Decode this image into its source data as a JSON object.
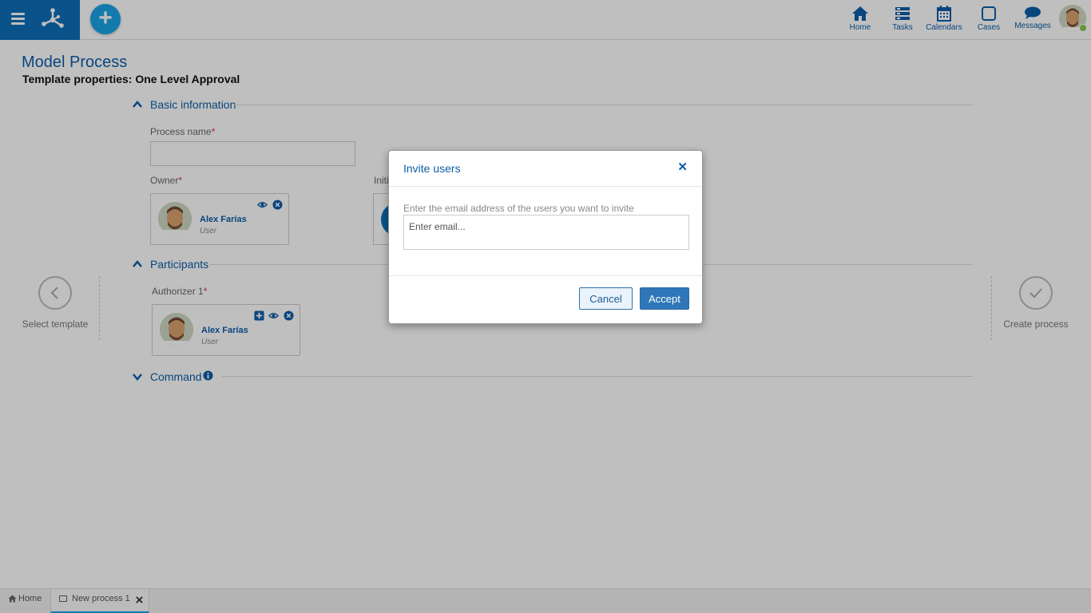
{
  "header": {
    "nav": [
      {
        "label": "Home",
        "icon": "home-icon"
      },
      {
        "label": "Tasks",
        "icon": "tasks-icon"
      },
      {
        "label": "Calendars",
        "icon": "calendar-icon"
      },
      {
        "label": "Cases",
        "icon": "cases-icon"
      },
      {
        "label": "Messages",
        "icon": "messages-icon"
      }
    ]
  },
  "page": {
    "title": "Model Process",
    "subtitle": "Template properties: One Level Approval"
  },
  "sections": {
    "basic": "Basic information",
    "participants": "Participants",
    "command": "Command"
  },
  "fields": {
    "process_name_label": "Process name",
    "owner_label": "Owner",
    "initiator_partial_label": "Initi",
    "authorizer_label": "Authorizer 1",
    "required_mark": "*"
  },
  "owner_card": {
    "name": "Alex Farías",
    "role": "User"
  },
  "authorizer_card": {
    "name": "Alex Farías",
    "role": "User"
  },
  "steps": {
    "prev": "Select template",
    "next": "Create process"
  },
  "bottom_tabs": [
    {
      "label": "Home",
      "icon": "home-icon"
    },
    {
      "label": "New process 1",
      "icon": "window-icon"
    }
  ],
  "modal": {
    "title": "Invite users",
    "instruction": "Enter the email address of the users you want to invite",
    "input_placeholder": "Enter email...",
    "cancel_label": "Cancel",
    "accept_label": "Accept"
  },
  "colors": {
    "brand_blue": "#0d6fb8",
    "accent_cyan": "#1aa3e8",
    "link_blue": "#0d5ea8"
  }
}
